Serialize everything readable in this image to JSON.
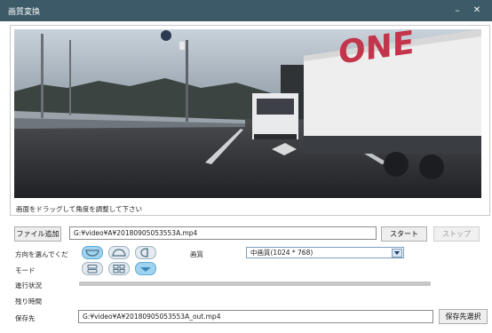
{
  "window": {
    "title": "画質変換",
    "minimize_glyph": "–",
    "close_glyph": "✕"
  },
  "preview": {
    "hint": "画面をドラッグして角度を調整して下さい"
  },
  "file": {
    "add_label": "ファイル追加",
    "path": "G:¥video¥A¥20180905053553A.mp4",
    "start_label": "スタート",
    "stop_label": "ストップ"
  },
  "direction": {
    "label": "方向を選んでくだ",
    "icons": [
      "bowl-down-icon",
      "dome-up-icon",
      "half-circle-side-icon"
    ]
  },
  "quality": {
    "label": "画質",
    "selected": "中画質(1024 * 768)"
  },
  "mode": {
    "label": "モード",
    "icons": [
      "two-rows-icon",
      "four-grid-icon",
      "hexagon-view-icon"
    ]
  },
  "progress": {
    "label": "進行状況",
    "value": 0
  },
  "remaining": {
    "label": "残り時間",
    "value": ""
  },
  "save": {
    "label": "保存先",
    "path": "G:¥video¥A¥20180905053553A_out.mp4",
    "browse_label": "保存先選択"
  },
  "colors": {
    "titlebar": "#3c5a68",
    "accent": "#9fd3ef"
  }
}
